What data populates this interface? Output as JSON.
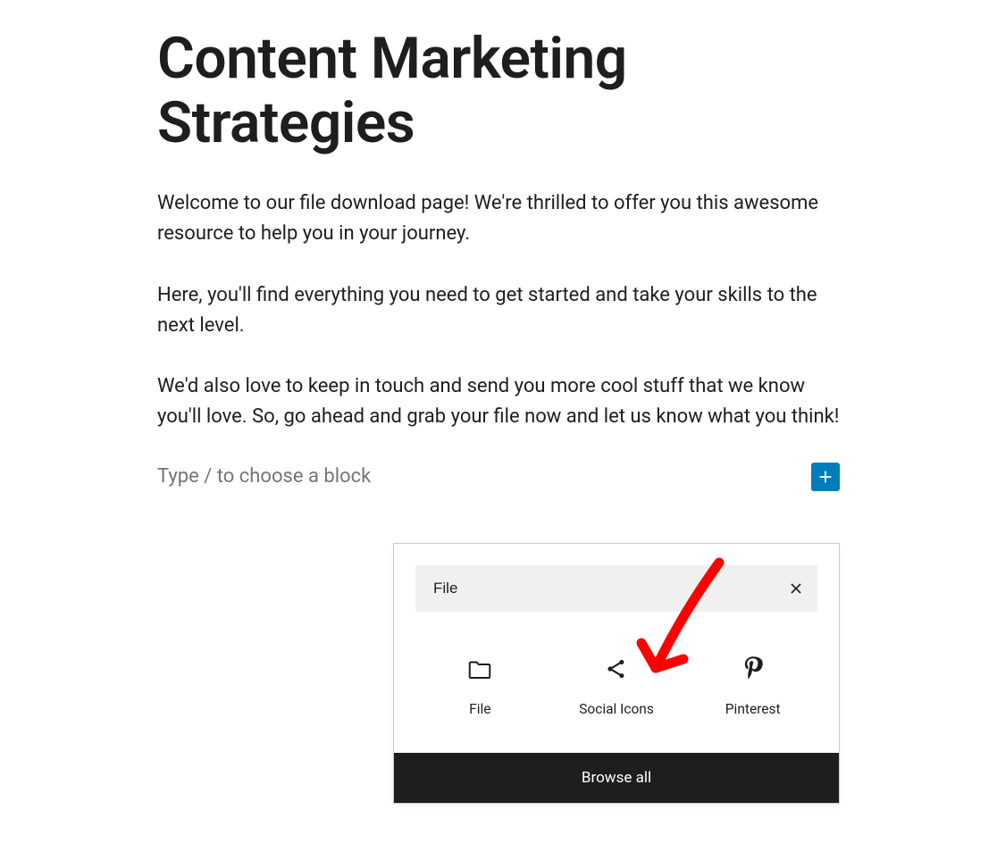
{
  "title": "Content Marketing Strategies",
  "paragraphs": [
    "Welcome to our file download page! We're thrilled to offer you this awesome resource to help you in your journey.",
    "Here, you'll find everything you need to get started and take your skills to the next level.",
    "We'd also love to keep in touch and send you more cool stuff that we know you'll love. So, go ahead and grab your file now and let us know what you think!"
  ],
  "block_placeholder": "Type / to choose a block",
  "inserter": {
    "search_value": "File",
    "items": [
      {
        "label": "File"
      },
      {
        "label": "Social Icons"
      },
      {
        "label": "Pinterest"
      }
    ],
    "browse_all": "Browse all"
  }
}
